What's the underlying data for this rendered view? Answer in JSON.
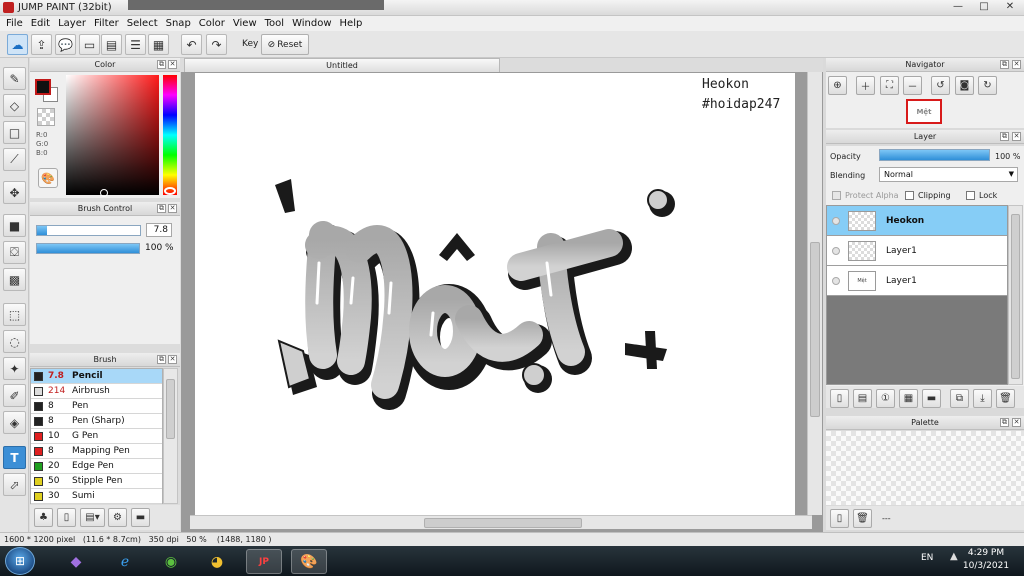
{
  "window": {
    "title": "JUMP PAINT (32bit)",
    "controls": [
      "—",
      "□",
      "✕"
    ]
  },
  "menu": [
    "File",
    "Edit",
    "Layer",
    "Filter",
    "Select",
    "Snap",
    "Color",
    "View",
    "Tool",
    "Window",
    "Help"
  ],
  "toolbar": {
    "key_label": "Key",
    "reset_label": "Reset"
  },
  "color_panel": {
    "title": "Color",
    "r": "R:0",
    "g": "G:0",
    "b": "B:0",
    "foreground": "#111111",
    "background": "#ffffff"
  },
  "brush_control": {
    "title": "Brush Control",
    "size": "7.8",
    "opacity": "100 %",
    "size_fraction": 0.1,
    "opacity_fraction": 1.0
  },
  "brush_panel": {
    "title": "Brush",
    "items": [
      {
        "size": "7.8",
        "name": "Pencil",
        "color": "#222222",
        "selected": true
      },
      {
        "size": "214",
        "name": "Airbrush",
        "color": "#dddddd"
      },
      {
        "size": "8",
        "name": "Pen",
        "color": "#222222"
      },
      {
        "size": "8",
        "name": "Pen (Sharp)",
        "color": "#222222"
      },
      {
        "size": "10",
        "name": "G Pen",
        "color": "#e02020"
      },
      {
        "size": "8",
        "name": "Mapping Pen",
        "color": "#e02020"
      },
      {
        "size": "20",
        "name": "Edge Pen",
        "color": "#20a020"
      },
      {
        "size": "50",
        "name": "Stipple Pen",
        "color": "#e0d020"
      },
      {
        "size": "30",
        "name": "Sumi",
        "color": "#e0d020"
      }
    ]
  },
  "canvas": {
    "tab_title": "Untitled",
    "watermark_line1": "Heokon",
    "watermark_line2": "#hoidap247",
    "art_text": "Mệt"
  },
  "navigator": {
    "title": "Navigator"
  },
  "layer_panel": {
    "title": "Layer",
    "opacity_label": "Opacity",
    "opacity_value": "100 %",
    "opacity_fraction": 1.0,
    "blending_label": "Blending",
    "blending_value": "Normal",
    "protect_alpha": "Protect Alpha",
    "clipping": "Clipping",
    "lock": "Lock",
    "layers": [
      {
        "name": "Heokon",
        "selected": true
      },
      {
        "name": "Layer1"
      },
      {
        "name": "Layer1"
      }
    ]
  },
  "palette_panel": {
    "title": "Palette",
    "footer_text": "---"
  },
  "status": {
    "text": "1600 * 1200 pixel   (11.6 * 8.7cm)   350 dpi   50 %    (1488, 1180 )"
  },
  "taskbar": {
    "language": "EN",
    "time": "4:29 PM",
    "date": "10/3/2021"
  }
}
